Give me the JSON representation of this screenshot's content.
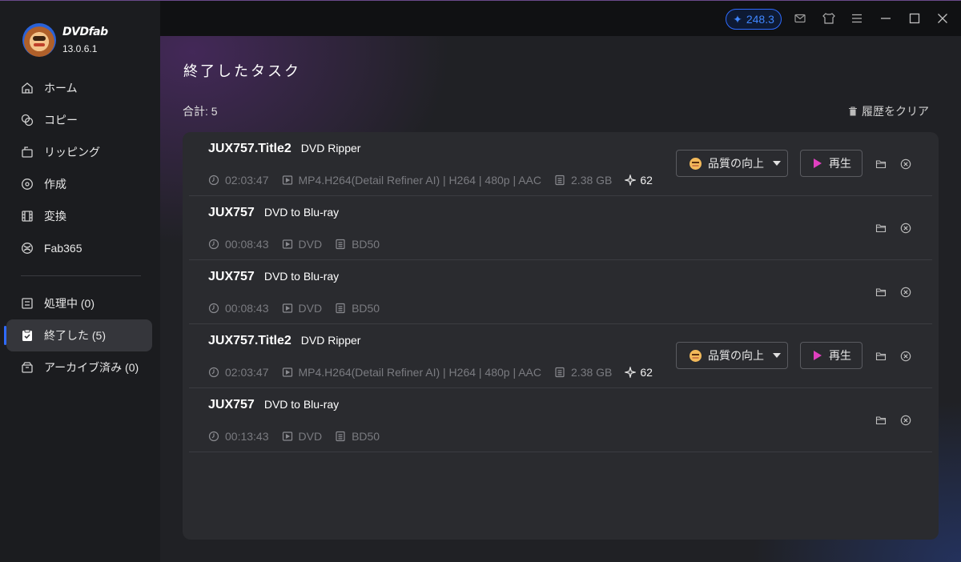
{
  "app": {
    "name": "DVDfab",
    "version": "13.0.6.1"
  },
  "sidebar": {
    "items": [
      {
        "label": "ホーム",
        "icon": "home-icon"
      },
      {
        "label": "コピー",
        "icon": "copy-icon"
      },
      {
        "label": "リッピング",
        "icon": "ripping-icon"
      },
      {
        "label": "作成",
        "icon": "create-icon"
      },
      {
        "label": "変換",
        "icon": "convert-icon"
      },
      {
        "label": "Fab365",
        "icon": "fab365-icon"
      }
    ],
    "task_items": [
      {
        "label": "処理中 (0)",
        "icon": "processing-icon"
      },
      {
        "label": "終了した (5)",
        "icon": "finished-icon",
        "active": true
      },
      {
        "label": "アーカイブ済み (0)",
        "icon": "archive-icon"
      }
    ]
  },
  "topbar": {
    "credits": "248.3"
  },
  "main": {
    "title": "終了したタスク",
    "total": "合計: 5",
    "clear_history": "履歴をクリア"
  },
  "tasks": [
    {
      "name": "JUX757.Title2",
      "type": "DVD Ripper",
      "duration": "02:03:47",
      "format": "MP4.H264(Detail Refiner AI) | H264 | 480p | AAC",
      "size": "2.38 GB",
      "score": "62",
      "quality_label": "品質の向上",
      "play_label": "再生"
    },
    {
      "name": "JUX757",
      "type": "DVD to Blu-ray",
      "duration": "00:08:43",
      "format": "DVD",
      "size": "BD50"
    },
    {
      "name": "JUX757",
      "type": "DVD to Blu-ray",
      "duration": "00:08:43",
      "format": "DVD",
      "size": "BD50"
    },
    {
      "name": "JUX757.Title2",
      "type": "DVD Ripper",
      "duration": "02:03:47",
      "format": "MP4.H264(Detail Refiner AI) | H264 | 480p | AAC",
      "size": "2.38 GB",
      "score": "62",
      "quality_label": "品質の向上",
      "play_label": "再生"
    },
    {
      "name": "JUX757",
      "type": "DVD to Blu-ray",
      "duration": "00:13:43",
      "format": "DVD",
      "size": "BD50"
    }
  ],
  "colors": {
    "accent": "#2f6bff",
    "play": "#e040c0"
  }
}
